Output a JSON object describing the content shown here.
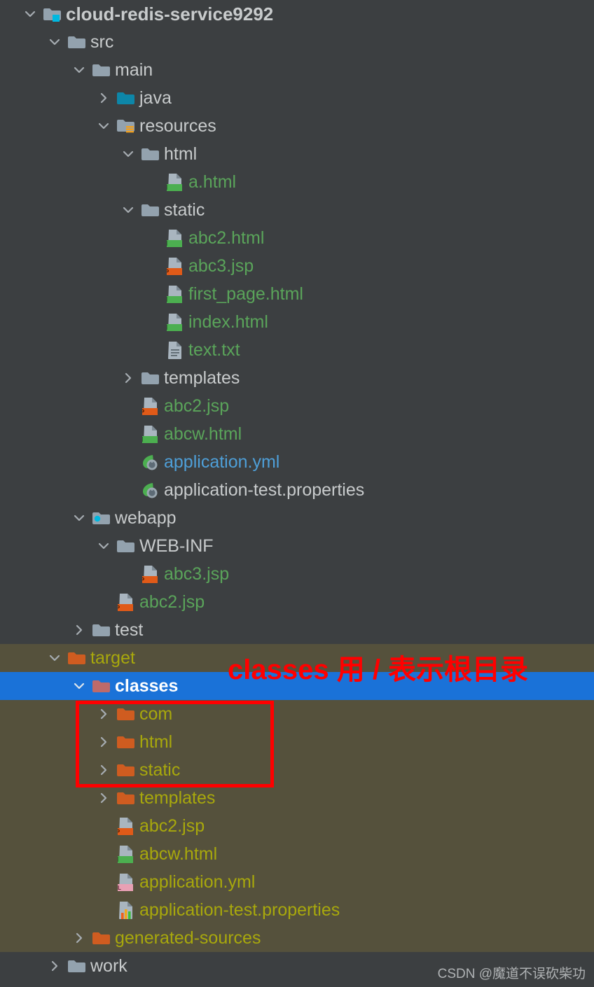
{
  "window": {
    "background": "#3c3f41",
    "target_zone_background": "#55513c",
    "selection_background": "#1a72d8"
  },
  "annotation": {
    "text": "classes 用 / 表示根目录",
    "color": "#ff0000",
    "box_color": "#ff0000"
  },
  "watermark": {
    "text": "CSDN @魔道不误砍柴功"
  },
  "tree": {
    "rows": [
      {
        "label": "cloud-redis-service9292",
        "depth": 0,
        "twisty": "chevron-down-icon",
        "icon": "module-folder-icon",
        "style": "root",
        "zone": "src"
      },
      {
        "label": "src",
        "depth": 1,
        "twisty": "chevron-down-icon",
        "icon": "folder-icon",
        "style": "dir",
        "zone": "src"
      },
      {
        "label": "main",
        "depth": 2,
        "twisty": "chevron-down-icon",
        "icon": "folder-icon",
        "style": "dir",
        "zone": "src"
      },
      {
        "label": "java",
        "depth": 3,
        "twisty": "chevron-right-icon",
        "icon": "source-root-folder-icon",
        "style": "dir",
        "zone": "src"
      },
      {
        "label": "resources",
        "depth": 3,
        "twisty": "chevron-down-icon",
        "icon": "resources-root-folder-icon",
        "style": "dir",
        "zone": "src"
      },
      {
        "label": "html",
        "depth": 4,
        "twisty": "chevron-down-icon",
        "icon": "folder-icon",
        "style": "dir",
        "zone": "src"
      },
      {
        "label": "a.html",
        "depth": 5,
        "twisty": "none",
        "icon": "html-file-icon",
        "style": "green",
        "zone": "src"
      },
      {
        "label": "static",
        "depth": 4,
        "twisty": "chevron-down-icon",
        "icon": "folder-icon",
        "style": "dir",
        "zone": "src"
      },
      {
        "label": "abc2.html",
        "depth": 5,
        "twisty": "none",
        "icon": "html-file-icon",
        "style": "green",
        "zone": "src"
      },
      {
        "label": "abc3.jsp",
        "depth": 5,
        "twisty": "none",
        "icon": "jsp-file-icon",
        "style": "green",
        "zone": "src"
      },
      {
        "label": "first_page.html",
        "depth": 5,
        "twisty": "none",
        "icon": "html-file-icon",
        "style": "green",
        "zone": "src"
      },
      {
        "label": "index.html",
        "depth": 5,
        "twisty": "none",
        "icon": "html-file-icon",
        "style": "green",
        "zone": "src"
      },
      {
        "label": "text.txt",
        "depth": 5,
        "twisty": "none",
        "icon": "text-file-icon",
        "style": "green",
        "zone": "src"
      },
      {
        "label": "templates",
        "depth": 4,
        "twisty": "chevron-right-icon",
        "icon": "folder-icon",
        "style": "dir",
        "zone": "src"
      },
      {
        "label": "abc2.jsp",
        "depth": 4,
        "twisty": "none",
        "icon": "jsp-file-icon",
        "style": "green",
        "zone": "src"
      },
      {
        "label": "abcw.html",
        "depth": 4,
        "twisty": "none",
        "icon": "html-file-icon",
        "style": "green",
        "zone": "src"
      },
      {
        "label": "application.yml",
        "depth": 4,
        "twisty": "none",
        "icon": "spring-config-icon",
        "style": "blue",
        "zone": "src"
      },
      {
        "label": "application-test.properties",
        "depth": 4,
        "twisty": "none",
        "icon": "spring-config-icon",
        "style": "plain",
        "zone": "src"
      },
      {
        "label": "webapp",
        "depth": 2,
        "twisty": "chevron-down-icon",
        "icon": "webapp-folder-icon",
        "style": "dir",
        "zone": "src"
      },
      {
        "label": "WEB-INF",
        "depth": 3,
        "twisty": "chevron-down-icon",
        "icon": "folder-icon",
        "style": "dir",
        "zone": "src"
      },
      {
        "label": "abc3.jsp",
        "depth": 4,
        "twisty": "none",
        "icon": "jsp-file-icon",
        "style": "green",
        "zone": "src"
      },
      {
        "label": "abc2.jsp",
        "depth": 3,
        "twisty": "none",
        "icon": "jsp-file-icon",
        "style": "green",
        "zone": "src"
      },
      {
        "label": "test",
        "depth": 2,
        "twisty": "chevron-right-icon",
        "icon": "folder-icon",
        "style": "dir",
        "zone": "src"
      },
      {
        "label": "target",
        "depth": 1,
        "twisty": "chevron-down-icon",
        "icon": "excluded-folder-icon",
        "style": "olive",
        "zone": "target"
      },
      {
        "label": "classes",
        "depth": 2,
        "twisty": "chevron-down-icon",
        "icon": "excluded-folder-selected-icon",
        "style": "white-sel",
        "zone": "target",
        "selected": true
      },
      {
        "label": "com",
        "depth": 3,
        "twisty": "chevron-right-icon",
        "icon": "excluded-folder-icon",
        "style": "olive",
        "zone": "target"
      },
      {
        "label": "html",
        "depth": 3,
        "twisty": "chevron-right-icon",
        "icon": "excluded-folder-icon",
        "style": "olive",
        "zone": "target"
      },
      {
        "label": "static",
        "depth": 3,
        "twisty": "chevron-right-icon",
        "icon": "excluded-folder-icon",
        "style": "olive",
        "zone": "target"
      },
      {
        "label": "templates",
        "depth": 3,
        "twisty": "chevron-right-icon",
        "icon": "excluded-folder-icon",
        "style": "olive",
        "zone": "target"
      },
      {
        "label": "abc2.jsp",
        "depth": 3,
        "twisty": "none",
        "icon": "jsp-file-icon",
        "style": "olive",
        "zone": "target"
      },
      {
        "label": "abcw.html",
        "depth": 3,
        "twisty": "none",
        "icon": "html-file-icon",
        "style": "olive",
        "zone": "target"
      },
      {
        "label": "application.yml",
        "depth": 3,
        "twisty": "none",
        "icon": "yml-file-icon",
        "style": "olive",
        "zone": "target"
      },
      {
        "label": "application-test.properties",
        "depth": 3,
        "twisty": "none",
        "icon": "properties-file-icon",
        "style": "olive",
        "zone": "target"
      },
      {
        "label": "generated-sources",
        "depth": 2,
        "twisty": "chevron-right-icon",
        "icon": "excluded-folder-icon",
        "style": "olive",
        "zone": "target"
      },
      {
        "label": "work",
        "depth": 1,
        "twisty": "chevron-right-icon",
        "icon": "folder-icon",
        "style": "dir",
        "zone": "src"
      }
    ]
  }
}
